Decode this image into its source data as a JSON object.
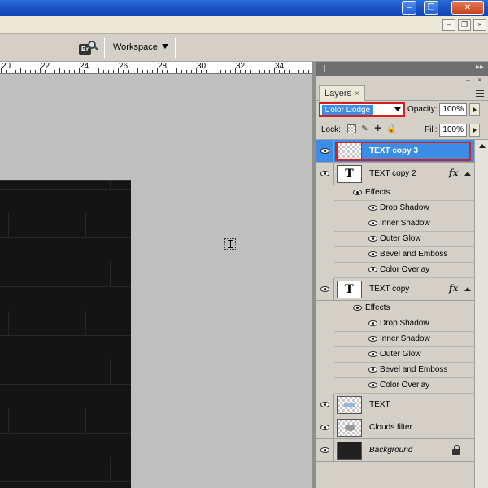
{
  "options_bar": {
    "bridge_icon": "br-bridge-search-icon",
    "workspace_label": "Workspace"
  },
  "ruler": {
    "labels": [
      "20",
      "22",
      "24",
      "26",
      "28",
      "30",
      "32",
      "34"
    ]
  },
  "layers_panel": {
    "tab_label": "Layers",
    "blend_mode": "Color Dodge",
    "opacity_label": "Opacity:",
    "opacity_value": "100%",
    "lock_label": "Lock:",
    "fill_label": "Fill:",
    "fill_value": "100%",
    "layers": [
      {
        "name": "TEXT copy 3",
        "selected": true,
        "thumb": "checker"
      },
      {
        "name": "TEXT copy 2",
        "thumb": "T",
        "fx": "fx",
        "effects_label": "Effects",
        "effects": [
          "Drop Shadow",
          "Inner Shadow",
          "Outer Glow",
          "Bevel and Emboss",
          "Color Overlay"
        ]
      },
      {
        "name": "TEXT copy",
        "thumb": "T",
        "fx": "fx",
        "effects_label": "Effects",
        "effects": [
          "Drop Shadow",
          "Inner Shadow",
          "Outer Glow",
          "Bevel and Emboss",
          "Color Overlay"
        ]
      },
      {
        "name": "TEXT",
        "thumb": "checker-text"
      },
      {
        "name": "Clouds filter",
        "thumb": "checker-cloud"
      },
      {
        "name": "Background",
        "thumb": "dark",
        "locked": true
      }
    ]
  },
  "colors": {
    "selection": "#3b8de6",
    "highlight_border": "#d62020",
    "titlebar": "#1d54c4"
  }
}
